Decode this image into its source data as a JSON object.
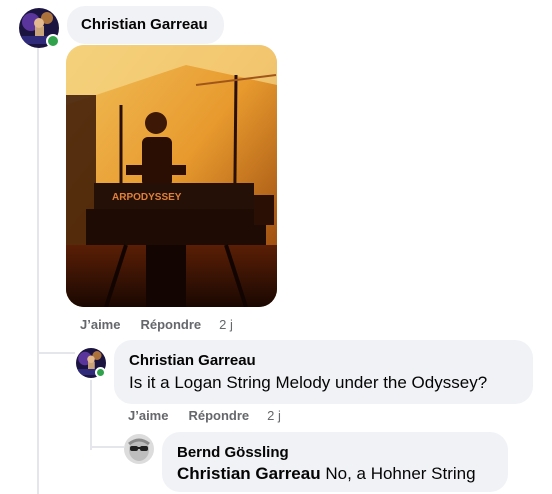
{
  "comment1": {
    "author": "Christian Garreau",
    "photo_keyboard_text": "ARPODYSSEY",
    "actions": {
      "like": "J’aime",
      "reply": "Répondre",
      "time": "2 j"
    }
  },
  "reply1": {
    "author": "Christian Garreau",
    "text": "Is it a Logan String Melody under the Odyssey?",
    "actions": {
      "like": "J’aime",
      "reply": "Répondre",
      "time": "2 j"
    }
  },
  "reply2": {
    "author": "Bernd Gössling",
    "mention": "Christian Garreau",
    "text": "No, a Hohner String"
  },
  "colors": {
    "bubble": "#f0f2f5",
    "online": "#31a24c",
    "secondary_text": "#65676b",
    "thread_line": "#e4e6eb"
  }
}
